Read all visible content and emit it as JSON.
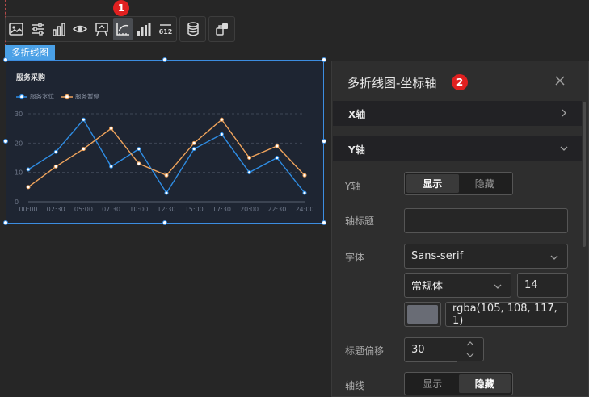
{
  "toolbar": {
    "groups": [
      {
        "icons": [
          "image-icon",
          "sliders-icon",
          "bar-chart-icon",
          "eye-icon",
          "display-icon",
          "axis-icon",
          "grid-bar-icon",
          "number-icon"
        ]
      },
      {
        "icons": [
          "database-icon"
        ]
      },
      {
        "icons": [
          "link-icon"
        ]
      }
    ],
    "number_icon_text": "612",
    "active": "axis-icon"
  },
  "markers": {
    "one": "1",
    "two": "2"
  },
  "component": {
    "tag": "多折线图",
    "title": "服务采购"
  },
  "chart_data": {
    "type": "line",
    "title": "服务采购",
    "categories": [
      "00:00",
      "02:30",
      "05:00",
      "07:30",
      "10:00",
      "12:30",
      "15:00",
      "17:30",
      "20:00",
      "22:30",
      "24:00"
    ],
    "ylim": [
      0,
      30
    ],
    "yticks": [
      0,
      10,
      20,
      30
    ],
    "grid": true,
    "legend_position": "top-left",
    "series": [
      {
        "name": "服务水位",
        "color": "#2f8de4",
        "values": [
          11,
          17,
          28,
          12,
          18,
          3,
          18,
          23,
          10,
          15,
          3
        ]
      },
      {
        "name": "服务暂停",
        "color": "#f0a45c",
        "values": [
          5,
          12,
          18,
          25,
          13,
          9,
          20,
          28,
          15,
          19,
          9
        ]
      }
    ]
  },
  "panel": {
    "title": "多折线图-坐标轴",
    "sections": {
      "x": "X轴",
      "y": "Y轴"
    },
    "y_axis": {
      "label": "Y轴",
      "options": [
        "显示",
        "隐藏"
      ],
      "selected": "显示"
    },
    "axis_title": {
      "label": "轴标题",
      "value": ""
    },
    "font": {
      "label": "字体",
      "family": "Sans-serif",
      "weight": "常规体",
      "size": "14",
      "color_text": "rgba(105, 108, 117, 1)",
      "color": "#696c75"
    },
    "title_offset": {
      "label": "标题偏移",
      "value": "30"
    },
    "axis_line": {
      "label": "轴线",
      "options": [
        "显示",
        "隐藏"
      ],
      "selected": "隐藏"
    }
  }
}
